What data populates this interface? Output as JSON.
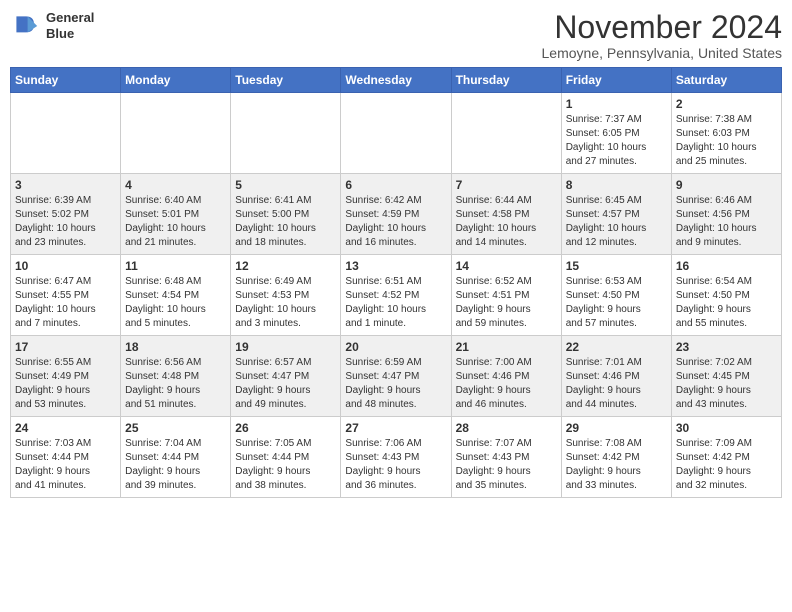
{
  "header": {
    "logo_line1": "General",
    "logo_line2": "Blue",
    "month": "November 2024",
    "location": "Lemoyne, Pennsylvania, United States"
  },
  "weekdays": [
    "Sunday",
    "Monday",
    "Tuesday",
    "Wednesday",
    "Thursday",
    "Friday",
    "Saturday"
  ],
  "weeks": [
    [
      {
        "day": "",
        "info": ""
      },
      {
        "day": "",
        "info": ""
      },
      {
        "day": "",
        "info": ""
      },
      {
        "day": "",
        "info": ""
      },
      {
        "day": "",
        "info": ""
      },
      {
        "day": "1",
        "info": "Sunrise: 7:37 AM\nSunset: 6:05 PM\nDaylight: 10 hours\nand 27 minutes."
      },
      {
        "day": "2",
        "info": "Sunrise: 7:38 AM\nSunset: 6:03 PM\nDaylight: 10 hours\nand 25 minutes."
      }
    ],
    [
      {
        "day": "3",
        "info": "Sunrise: 6:39 AM\nSunset: 5:02 PM\nDaylight: 10 hours\nand 23 minutes."
      },
      {
        "day": "4",
        "info": "Sunrise: 6:40 AM\nSunset: 5:01 PM\nDaylight: 10 hours\nand 21 minutes."
      },
      {
        "day": "5",
        "info": "Sunrise: 6:41 AM\nSunset: 5:00 PM\nDaylight: 10 hours\nand 18 minutes."
      },
      {
        "day": "6",
        "info": "Sunrise: 6:42 AM\nSunset: 4:59 PM\nDaylight: 10 hours\nand 16 minutes."
      },
      {
        "day": "7",
        "info": "Sunrise: 6:44 AM\nSunset: 4:58 PM\nDaylight: 10 hours\nand 14 minutes."
      },
      {
        "day": "8",
        "info": "Sunrise: 6:45 AM\nSunset: 4:57 PM\nDaylight: 10 hours\nand 12 minutes."
      },
      {
        "day": "9",
        "info": "Sunrise: 6:46 AM\nSunset: 4:56 PM\nDaylight: 10 hours\nand 9 minutes."
      }
    ],
    [
      {
        "day": "10",
        "info": "Sunrise: 6:47 AM\nSunset: 4:55 PM\nDaylight: 10 hours\nand 7 minutes."
      },
      {
        "day": "11",
        "info": "Sunrise: 6:48 AM\nSunset: 4:54 PM\nDaylight: 10 hours\nand 5 minutes."
      },
      {
        "day": "12",
        "info": "Sunrise: 6:49 AM\nSunset: 4:53 PM\nDaylight: 10 hours\nand 3 minutes."
      },
      {
        "day": "13",
        "info": "Sunrise: 6:51 AM\nSunset: 4:52 PM\nDaylight: 10 hours\nand 1 minute."
      },
      {
        "day": "14",
        "info": "Sunrise: 6:52 AM\nSunset: 4:51 PM\nDaylight: 9 hours\nand 59 minutes."
      },
      {
        "day": "15",
        "info": "Sunrise: 6:53 AM\nSunset: 4:50 PM\nDaylight: 9 hours\nand 57 minutes."
      },
      {
        "day": "16",
        "info": "Sunrise: 6:54 AM\nSunset: 4:50 PM\nDaylight: 9 hours\nand 55 minutes."
      }
    ],
    [
      {
        "day": "17",
        "info": "Sunrise: 6:55 AM\nSunset: 4:49 PM\nDaylight: 9 hours\nand 53 minutes."
      },
      {
        "day": "18",
        "info": "Sunrise: 6:56 AM\nSunset: 4:48 PM\nDaylight: 9 hours\nand 51 minutes."
      },
      {
        "day": "19",
        "info": "Sunrise: 6:57 AM\nSunset: 4:47 PM\nDaylight: 9 hours\nand 49 minutes."
      },
      {
        "day": "20",
        "info": "Sunrise: 6:59 AM\nSunset: 4:47 PM\nDaylight: 9 hours\nand 48 minutes."
      },
      {
        "day": "21",
        "info": "Sunrise: 7:00 AM\nSunset: 4:46 PM\nDaylight: 9 hours\nand 46 minutes."
      },
      {
        "day": "22",
        "info": "Sunrise: 7:01 AM\nSunset: 4:46 PM\nDaylight: 9 hours\nand 44 minutes."
      },
      {
        "day": "23",
        "info": "Sunrise: 7:02 AM\nSunset: 4:45 PM\nDaylight: 9 hours\nand 43 minutes."
      }
    ],
    [
      {
        "day": "24",
        "info": "Sunrise: 7:03 AM\nSunset: 4:44 PM\nDaylight: 9 hours\nand 41 minutes."
      },
      {
        "day": "25",
        "info": "Sunrise: 7:04 AM\nSunset: 4:44 PM\nDaylight: 9 hours\nand 39 minutes."
      },
      {
        "day": "26",
        "info": "Sunrise: 7:05 AM\nSunset: 4:44 PM\nDaylight: 9 hours\nand 38 minutes."
      },
      {
        "day": "27",
        "info": "Sunrise: 7:06 AM\nSunset: 4:43 PM\nDaylight: 9 hours\nand 36 minutes."
      },
      {
        "day": "28",
        "info": "Sunrise: 7:07 AM\nSunset: 4:43 PM\nDaylight: 9 hours\nand 35 minutes."
      },
      {
        "day": "29",
        "info": "Sunrise: 7:08 AM\nSunset: 4:42 PM\nDaylight: 9 hours\nand 33 minutes."
      },
      {
        "day": "30",
        "info": "Sunrise: 7:09 AM\nSunset: 4:42 PM\nDaylight: 9 hours\nand 32 minutes."
      }
    ]
  ]
}
